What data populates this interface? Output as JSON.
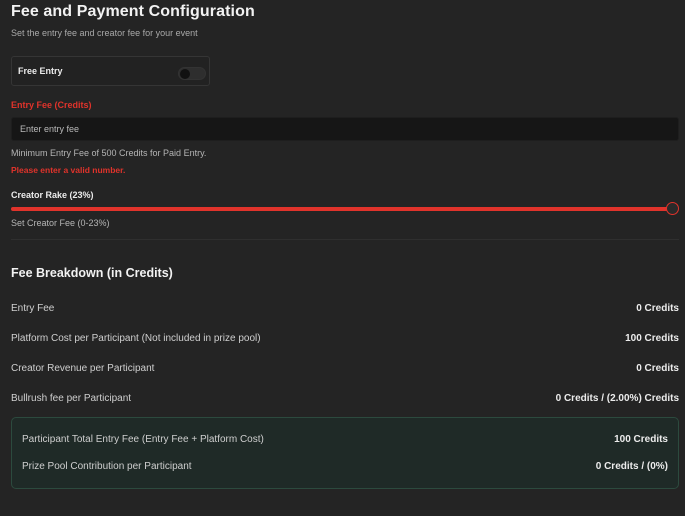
{
  "header": {
    "title": "Fee and Payment Configuration",
    "subtitle": "Set the entry fee and creator fee for your event"
  },
  "free_entry": {
    "label": "Free Entry",
    "enabled": false
  },
  "entry_fee": {
    "label": "Entry Fee (Credits)",
    "placeholder": "Enter entry fee",
    "value": "",
    "min_note": "Minimum Entry Fee of 500 Credits for Paid Entry.",
    "error": "Please enter a valid number."
  },
  "creator_rake": {
    "label": "Creator Rake (23%)",
    "help": "Set Creator Fee (0-23%)",
    "value_percent": 23,
    "min_percent": 0,
    "max_percent": 23
  },
  "breakdown": {
    "title": "Fee Breakdown (in Credits)",
    "rows": [
      {
        "label": "Entry Fee",
        "value": "0 Credits"
      },
      {
        "label": "Platform Cost per Participant (Not included in prize pool)",
        "value": "100 Credits"
      },
      {
        "label": "Creator Revenue per Participant",
        "value": "0 Credits"
      },
      {
        "label": "Bullrush fee per Participant",
        "value": "0 Credits / (2.00%) Credits"
      }
    ],
    "summary": [
      {
        "label": "Participant Total Entry Fee (Entry Fee + Platform Cost)",
        "value": "100 Credits"
      },
      {
        "label": "Prize Pool Contribution per Participant",
        "value": "0 Credits / (0%)"
      }
    ]
  },
  "colors": {
    "accent": "#e0332b",
    "background": "#242424",
    "summary_border": "#2c4a3e"
  }
}
